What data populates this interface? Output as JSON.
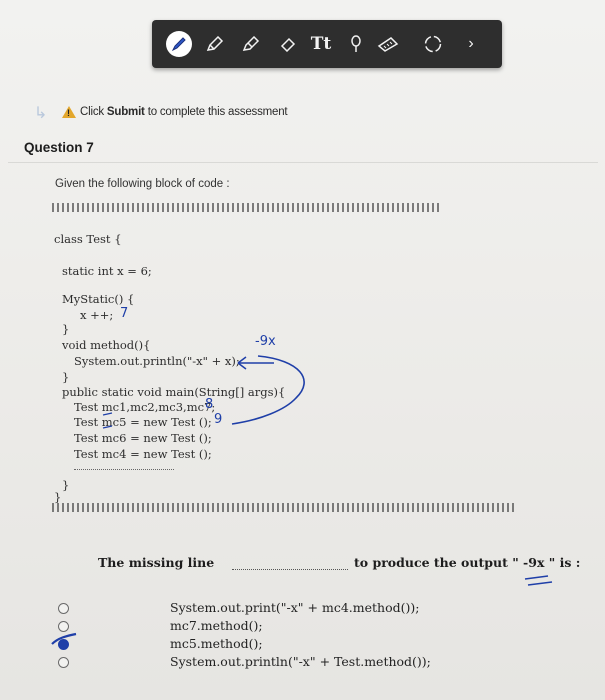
{
  "toolbar": {
    "tools": [
      "pen-tool",
      "marker-tool",
      "highlighter-tool",
      "eraser-tool",
      "text-tool",
      "lasso-tool",
      "ruler-tool",
      "color-picker",
      "next-arrow"
    ],
    "text_tool_label": "Tt"
  },
  "notice": {
    "bold": "Submit",
    "prefix": "Click ",
    "suffix": " to complete this assessment"
  },
  "question": {
    "title": "Question 7",
    "prompt": "Given the following block of code :",
    "code": {
      "l1": "class Test {",
      "l2": "static int x = 6;",
      "l3": "MyStatic() {",
      "l4": "x ++;",
      "l5": "}",
      "l6": "void method(){",
      "l7": "System.out.println(\"-x\" + x);",
      "l8": "}",
      "l9": "public static void main(String[] args){",
      "l10": "Test mc1,mc2,mc3,mc7;",
      "l11": "Test mc5 = new Test ();",
      "l12": "Test mc6 = new Test ();",
      "l13": "Test mc4 = new Test ();",
      "l14": "}",
      "l15": "}"
    },
    "handwriting": {
      "a": "7",
      "b": "-9x",
      "c": "8",
      "d": "9"
    },
    "missing_prefix": "The missing line",
    "missing_suffix": "to produce the output \" -9x \" is :",
    "options": [
      "System.out.print(\"-x\" + mc4.method());",
      "mc7.method();",
      "mc5.method();",
      "System.out.println(\"-x\" + Test.method());"
    ],
    "selected_index": 2
  },
  "colors": {
    "ink": "#1f3fa8",
    "toolbar": "#2e2e2e",
    "warning": "#e3a72c"
  }
}
